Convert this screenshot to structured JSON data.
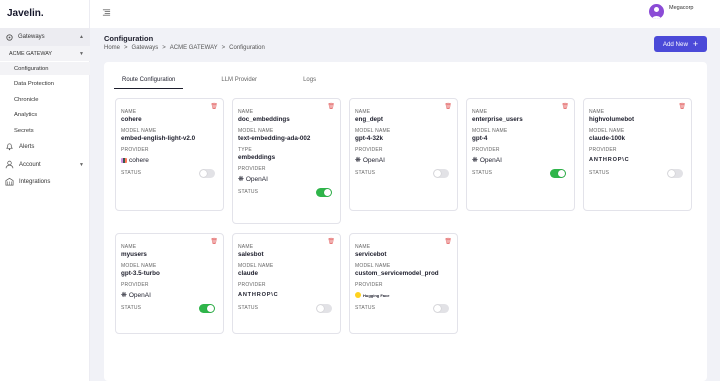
{
  "app": {
    "logo": "Javelin."
  },
  "sidebar": {
    "gateways": "Gateways",
    "gateway_selected": "ACME GATEWAY",
    "sub_items": [
      "Configuration",
      "Data Protection",
      "Chronicle",
      "Analytics",
      "Secrets"
    ],
    "active_sub": "Configuration",
    "alerts": "Alerts",
    "account": "Account",
    "integrations": "Integrations"
  },
  "topbar": {
    "org_name": "Megacorp"
  },
  "page": {
    "title": "Configuration",
    "breadcrumb": [
      "Home",
      "Gateways",
      "ACME GATEWAY",
      "Configuration"
    ],
    "breadcrumb_sep": ">",
    "add_button": "Add New",
    "add_icon": "+"
  },
  "tabs": [
    "Route Configuration",
    "LLM Provider",
    "Logs"
  ],
  "active_tab": "Route Configuration",
  "labels": {
    "name": "NAME",
    "model_name": "MODEL NAME",
    "type": "TYPE",
    "provider": "PROVIDER",
    "status": "STATUS"
  },
  "cards": [
    {
      "name": "cohere",
      "model": "embed-english-light-v2.0",
      "provider": "cohere",
      "provider_logo": "cohere",
      "status_on": false
    },
    {
      "name": "doc_embeddings",
      "model": "text-embedding-ada-002",
      "type": "embeddings",
      "provider": "OpenAI",
      "provider_logo": "openai",
      "status_on": true
    },
    {
      "name": "eng_dept",
      "model": "gpt-4-32k",
      "provider": "OpenAI",
      "provider_logo": "openai",
      "status_on": false
    },
    {
      "name": "enterprise_users",
      "model": "gpt-4",
      "provider": "OpenAI",
      "provider_logo": "openai",
      "status_on": true
    },
    {
      "name": "highvolumebot",
      "model": "claude-100k",
      "provider": "ANTHROP\\C",
      "provider_logo": "anthropic",
      "status_on": false
    },
    {
      "name": "myusers",
      "model": "gpt-3.5-turbo",
      "provider": "OpenAI",
      "provider_logo": "openai",
      "status_on": true
    },
    {
      "name": "salesbot",
      "model": "claude",
      "provider": "ANTHROP\\C",
      "provider_logo": "anthropic",
      "status_on": false
    },
    {
      "name": "servicebot",
      "model": "custom_servicemodel_prod",
      "provider": "Hugging Face",
      "provider_logo": "huggingface",
      "status_on": false
    }
  ],
  "icons": {
    "gateways": "gear-icon",
    "alerts": "bell-icon",
    "account": "user-icon",
    "integrations": "building-icon",
    "menu": "menu-icon",
    "delete": "trash-icon"
  },
  "colors": {
    "accent": "#4b4ad8",
    "toggle_on": "#2fb54a",
    "toggle_off": "#e2e2e6",
    "delete": "#e05555",
    "avatar": "#8b4bd6"
  }
}
